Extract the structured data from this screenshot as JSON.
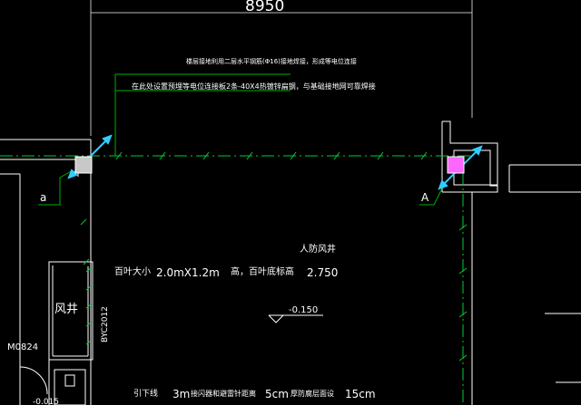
{
  "drawing": {
    "dimension_top": "8950",
    "note_line_1": "楼层接地利用二层水平钢筋(Φ16)接地焊接，形成等电位连接",
    "note_line_2": "在此处设置预埋等电位连接板2条-40X4热镀锌扁钢，与基础接地网可靠焊接",
    "axis_label_left": "a",
    "axis_label_right": "A",
    "shaft_title": "人防风井",
    "louver_label": "百叶大小",
    "louver_size": "2.0mX1.2m",
    "louver_bottom_label": "高，百叶底标高",
    "louver_bottom_value": "2.750",
    "level_mark": "-0.150",
    "shaft_room": "风井",
    "door_tag": "M0824",
    "wall_tag": "BYC2012",
    "bottom_label_1": "引下线",
    "bottom_value_1": "3m",
    "bottom_label_2": "接闪器和避雷针距离",
    "bottom_value_2": "5cm",
    "bottom_label_3": "厚防腐层面设",
    "bottom_value_3": "15cm",
    "small_value": "-0.015"
  },
  "colors": {
    "background": "#000000",
    "wall_lines": "#ffffff",
    "green_grid": "#00cc33",
    "leader_green": "#00b000",
    "cyan_arrow": "#33ccff",
    "magenta_column": "#ff33ff",
    "gray_column": "#c8c8c8"
  }
}
